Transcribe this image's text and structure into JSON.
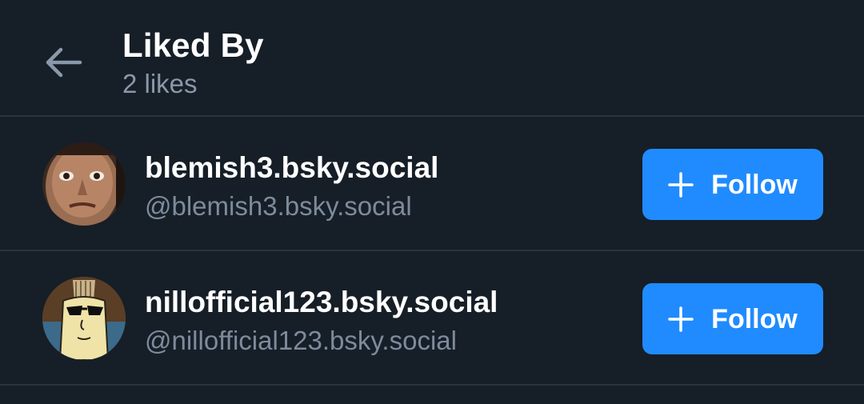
{
  "header": {
    "title": "Liked By",
    "subtitle": "2 likes"
  },
  "users": [
    {
      "display_name": "blemish3.bsky.social",
      "handle": "@blemish3.bsky.social",
      "follow_label": "Follow"
    },
    {
      "display_name": "nillofficial123.bsky.social",
      "handle": "@nillofficial123.bsky.social",
      "follow_label": "Follow"
    }
  ],
  "colors": {
    "background": "#161e27",
    "divider": "#2a333f",
    "accent": "#208bfe",
    "secondary_text": "#8a98aa"
  },
  "icons": {
    "back": "arrow-left-icon",
    "follow": "plus-icon"
  }
}
